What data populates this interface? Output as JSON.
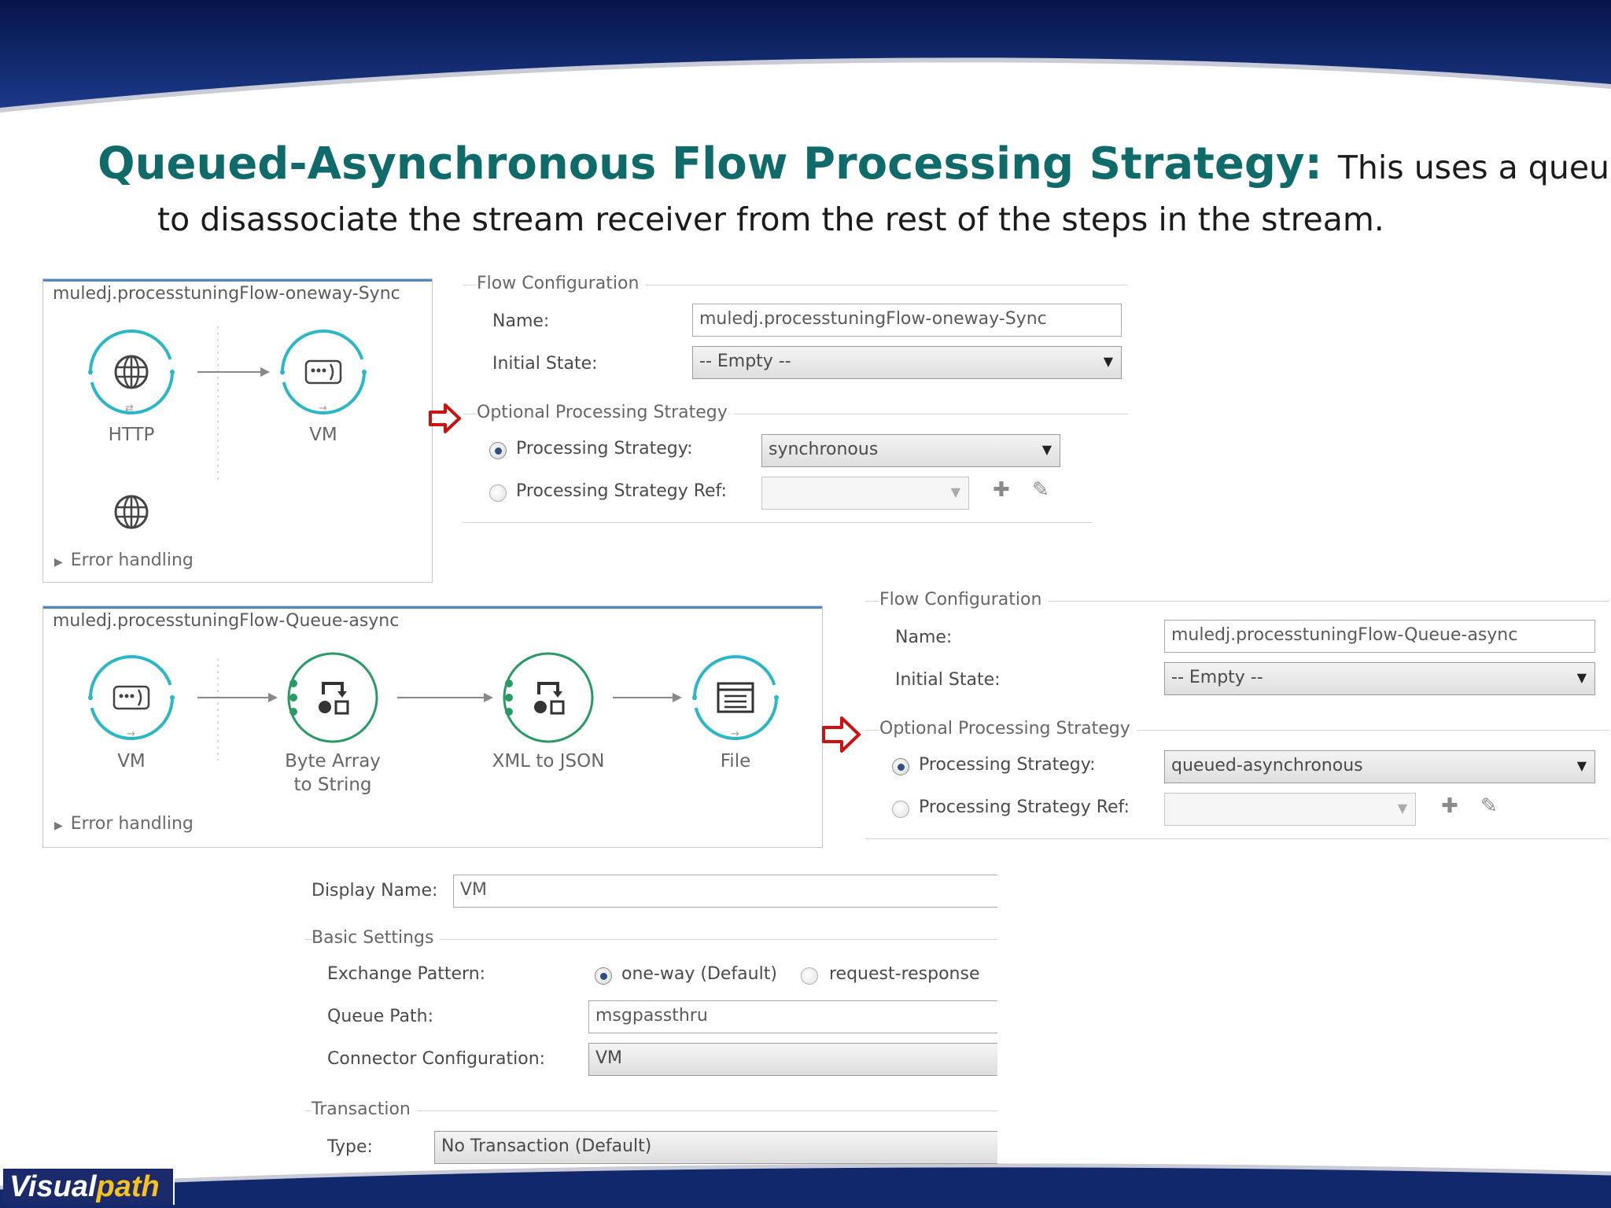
{
  "slide": {
    "title": "Queued-Asynchronous Flow Processing Strategy:",
    "subtitle_part1": "This uses a queue",
    "subtitle_part2": "to disassociate the stream receiver from the rest of the steps in the stream.",
    "logo_part1": "Visual",
    "logo_part2": "path"
  },
  "flow1": {
    "name": "muledj.processtuningFlow-oneway-Sync",
    "nodes": [
      {
        "label": "HTTP",
        "icon": "globe-icon"
      },
      {
        "label": "VM",
        "icon": "vm-endpoint-icon"
      }
    ],
    "error_handling": "Error handling"
  },
  "config1": {
    "flow_configuration": "Flow Configuration",
    "name_label": "Name:",
    "name_value": "muledj.processtuningFlow-oneway-Sync",
    "initial_state_label": "Initial State:",
    "initial_state_value": "-- Empty --",
    "optional_processing": "Optional Processing Strategy",
    "ps_label": "Processing Strategy:",
    "ps_value": "synchronous",
    "ps_ref_label": "Processing Strategy Ref:",
    "ps_ref_value": ""
  },
  "flow2": {
    "name": "muledj.processtuningFlow-Queue-async",
    "nodes": [
      {
        "label": "VM",
        "icon": "vm-endpoint-icon"
      },
      {
        "label": "Byte Array to String",
        "icon": "transformer-icon"
      },
      {
        "label": "XML to JSON",
        "icon": "transformer-icon"
      },
      {
        "label": "File",
        "icon": "file-endpoint-icon"
      }
    ],
    "error_handling": "Error handling"
  },
  "config2": {
    "flow_configuration": "Flow Configuration",
    "name_label": "Name:",
    "name_value": "muledj.processtuningFlow-Queue-async",
    "initial_state_label": "Initial State:",
    "initial_state_value": "-- Empty --",
    "optional_processing": "Optional Processing Strategy",
    "ps_label": "Processing Strategy:",
    "ps_value": "queued-asynchronous",
    "ps_ref_label": "Processing Strategy Ref:",
    "ps_ref_value": ""
  },
  "vm_props": {
    "display_name_label": "Display Name:",
    "display_name_value": "VM",
    "basic_settings": "Basic Settings",
    "exchange_pattern_label": "Exchange Pattern:",
    "exchange_option1": "one-way (Default)",
    "exchange_option2": "request-response",
    "queue_path_label": "Queue Path:",
    "queue_path_value": "msgpassthru",
    "connector_config_label": "Connector Configuration:",
    "connector_config_value": "VM",
    "transaction": "Transaction",
    "type_label": "Type:",
    "type_value": "No Transaction (Default)"
  },
  "colors": {
    "banner": "#0d1f5c",
    "title": "#0f6a6a",
    "node_ring_cyan": "#2bb7c6",
    "node_ring_green": "#2a9a64",
    "pointer_arrow": "#cc1111"
  }
}
